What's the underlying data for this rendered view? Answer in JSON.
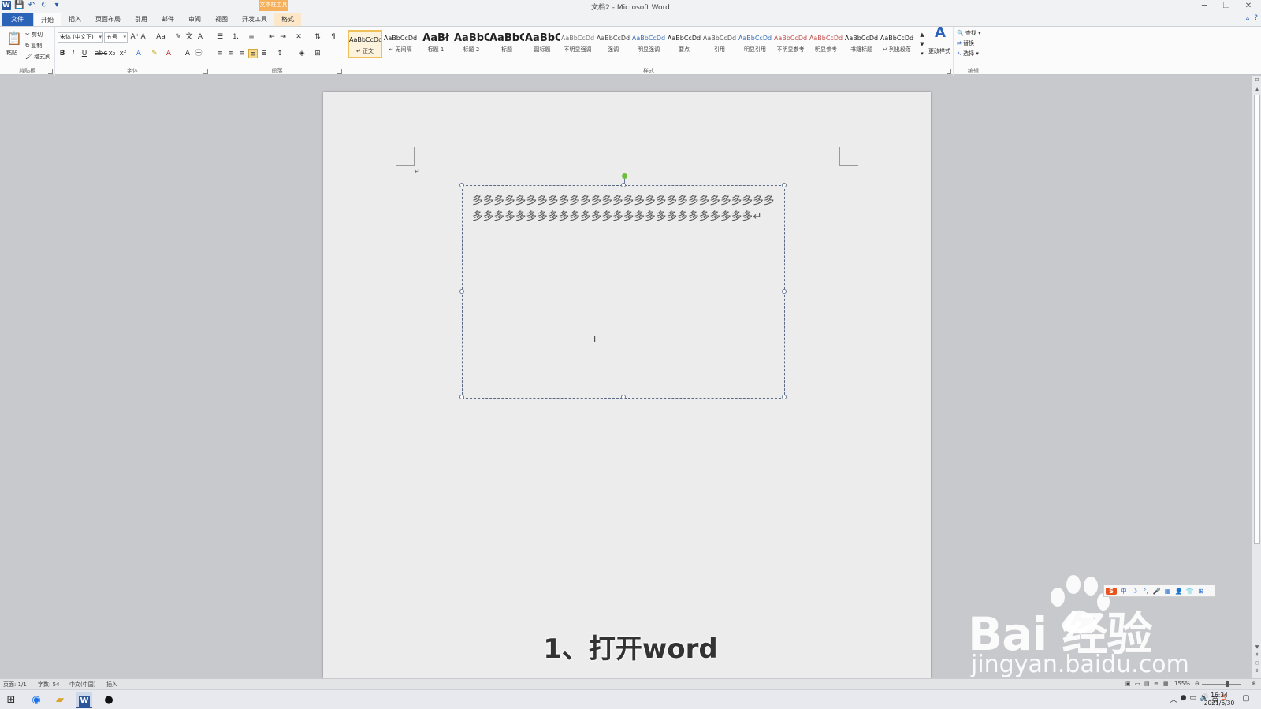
{
  "window": {
    "title": "文档2 - Microsoft Word",
    "context_group": "文本框工具",
    "controls": {
      "minimize": "─",
      "restore": "❐",
      "close": "✕"
    }
  },
  "tabs": [
    {
      "label": "文件",
      "kind": "file"
    },
    {
      "label": "开始",
      "kind": "active"
    },
    {
      "label": "插入",
      "kind": "normal"
    },
    {
      "label": "页面布局",
      "kind": "normal"
    },
    {
      "label": "引用",
      "kind": "normal"
    },
    {
      "label": "邮件",
      "kind": "normal"
    },
    {
      "label": "审阅",
      "kind": "normal"
    },
    {
      "label": "视图",
      "kind": "normal"
    },
    {
      "label": "开发工具",
      "kind": "normal"
    },
    {
      "label": "格式",
      "kind": "context"
    }
  ],
  "ribbon": {
    "clipboard": {
      "label": "剪贴板",
      "paste": "粘贴",
      "cut": "剪切",
      "copy": "复制",
      "format_painter": "格式刷"
    },
    "font": {
      "label": "字体",
      "font_name": "宋体 (中文正)",
      "font_size": "五号"
    },
    "paragraph": {
      "label": "段落"
    },
    "styles": {
      "label": "样式",
      "change_styles": "更改样式",
      "items": [
        {
          "sample": "AaBbCcDd",
          "name": "↵ 正文",
          "color": "#222222",
          "selected": true
        },
        {
          "sample": "AaBbCcDd",
          "name": "↵ 无间隔",
          "color": "#222222"
        },
        {
          "sample": "AaBł",
          "name": "标题 1",
          "color": "#222222",
          "big": true
        },
        {
          "sample": "AaBbC",
          "name": "标题 2",
          "color": "#222222",
          "big": true
        },
        {
          "sample": "AaBbC",
          "name": "标题",
          "color": "#222222",
          "big": true
        },
        {
          "sample": "AaBbC",
          "name": "副标题",
          "color": "#222222",
          "big": true
        },
        {
          "sample": "AaBbCcDd",
          "name": "不明显强调",
          "color": "#777777"
        },
        {
          "sample": "AaBbCcDd",
          "name": "强调",
          "color": "#444444"
        },
        {
          "sample": "AaBbCcDd",
          "name": "明显强调",
          "color": "#3a6fb5"
        },
        {
          "sample": "AaBbCcDd",
          "name": "要点",
          "color": "#222222"
        },
        {
          "sample": "AaBbCcDd",
          "name": "引用",
          "color": "#555555"
        },
        {
          "sample": "AaBbCcDd",
          "name": "明显引用",
          "color": "#3a6fb5"
        },
        {
          "sample": "AaBbCcDd",
          "name": "不明显参考",
          "color": "#c0504d"
        },
        {
          "sample": "AaBbCcDd",
          "name": "明显参考",
          "color": "#c0504d"
        },
        {
          "sample": "AaBbCcDd",
          "name": "书籍标题",
          "color": "#222222"
        },
        {
          "sample": "AaBbCcDd",
          "name": "↵ 列出段落",
          "color": "#222222"
        }
      ]
    },
    "editing": {
      "label": "编辑",
      "find": "查找",
      "replace": "替换",
      "select": "选择"
    }
  },
  "document": {
    "textbox_line1": "多多多多多多多多多多多多多多多多多多多多多多多多多多多多",
    "textbox_line2": "多多多多多多多多多多多多多多多多多多多多多多多多多多↵",
    "para_mark": "↵",
    "caption": "1、打开word"
  },
  "watermark": {
    "brand": "Bai  经验",
    "url": "jingyan.baidu.com"
  },
  "ime": {
    "items": [
      "S",
      "中",
      "☽",
      "°,",
      "🎤",
      "▦",
      "👤",
      "👕",
      "⊞"
    ]
  },
  "statusbar": {
    "page": "页面: 1/1",
    "words": "字数: 54",
    "language": "中文(中国)",
    "mode": "插入",
    "zoom": "155%"
  },
  "taskbar": {
    "time": "16:34",
    "date": "2021/6/30"
  },
  "colors": {
    "file_tab": "#2b63b8",
    "context_tab": "#f4b05a",
    "selected_style": "#f0c15a"
  }
}
